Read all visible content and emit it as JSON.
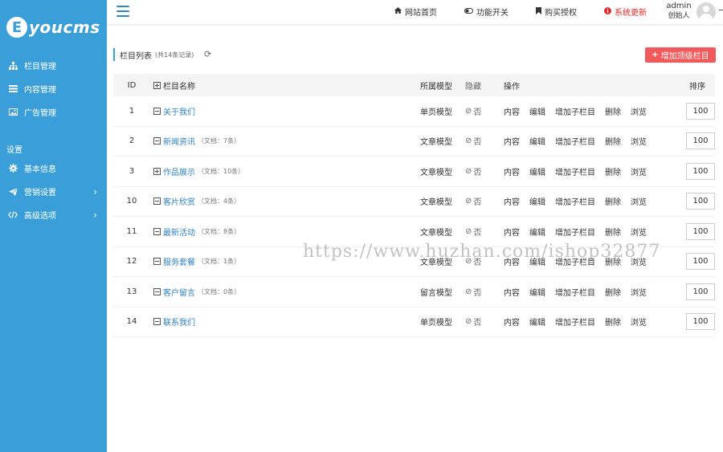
{
  "brand": {
    "logo_letter": "E",
    "logo_text": "youcms"
  },
  "sidebar": {
    "items": [
      {
        "label": "栏目管理",
        "icon": "sitemap-icon"
      },
      {
        "label": "内容管理",
        "icon": "list-icon"
      },
      {
        "label": "广告管理",
        "icon": "image-icon"
      }
    ],
    "section_label": "设置",
    "settings": [
      {
        "label": "基本信息",
        "icon": "gear-icon"
      },
      {
        "label": "营销设置",
        "icon": "paper-plane-icon",
        "has_arrow": true
      },
      {
        "label": "高级选项",
        "icon": "code-icon",
        "has_arrow": true
      }
    ]
  },
  "topbar": {
    "home": "网站首页",
    "feature": "功能开关",
    "buy": "购买授权",
    "update": "系统更新",
    "user_name": "admin",
    "user_role": "创始人"
  },
  "panel": {
    "title": "栏目列表",
    "count": "(共14条记录)",
    "add_button": "增加顶级栏目"
  },
  "table": {
    "headers": {
      "id": "ID",
      "name": "栏目名称",
      "model": "所属模型",
      "hide": "隐藏",
      "ops": "操作",
      "sort": "排序"
    },
    "ops": [
      "内容",
      "编辑",
      "增加子栏目",
      "删除",
      "浏览"
    ],
    "rows": [
      {
        "id": "1",
        "name": "关于我们",
        "doc": "",
        "model": "单页模型",
        "hide": "否",
        "sort": "100",
        "expanded": true
      },
      {
        "id": "2",
        "name": "新闻资讯",
        "doc": "（文档：7条）",
        "model": "文章模型",
        "hide": "否",
        "sort": "100",
        "expanded": true
      },
      {
        "id": "3",
        "name": "作品展示",
        "doc": "（文档：10条）",
        "model": "文章模型",
        "hide": "否",
        "sort": "100",
        "expanded": false
      },
      {
        "id": "10",
        "name": "客片欣赏",
        "doc": "（文档：4条）",
        "model": "文章模型",
        "hide": "否",
        "sort": "100",
        "expanded": true
      },
      {
        "id": "11",
        "name": "最新活动",
        "doc": "（文档：8条）",
        "model": "文章模型",
        "hide": "否",
        "sort": "100",
        "expanded": true
      },
      {
        "id": "12",
        "name": "服务套餐",
        "doc": "（文档：1条）",
        "model": "文章模型",
        "hide": "否",
        "sort": "100",
        "expanded": true
      },
      {
        "id": "13",
        "name": "客户留言",
        "doc": "（文档：0条）",
        "model": "留言模型",
        "hide": "否",
        "sort": "100",
        "expanded": true
      },
      {
        "id": "14",
        "name": "联系我们",
        "doc": "",
        "model": "单页模型",
        "hide": "否",
        "sort": "100",
        "expanded": true
      }
    ]
  },
  "watermark": "https://www.huzhan.com/ishop32877",
  "colors": {
    "sidebar": "#3a9fd8",
    "accent": "#2e82c4",
    "danger": "#f05a5a",
    "update": "#e02a2a"
  }
}
